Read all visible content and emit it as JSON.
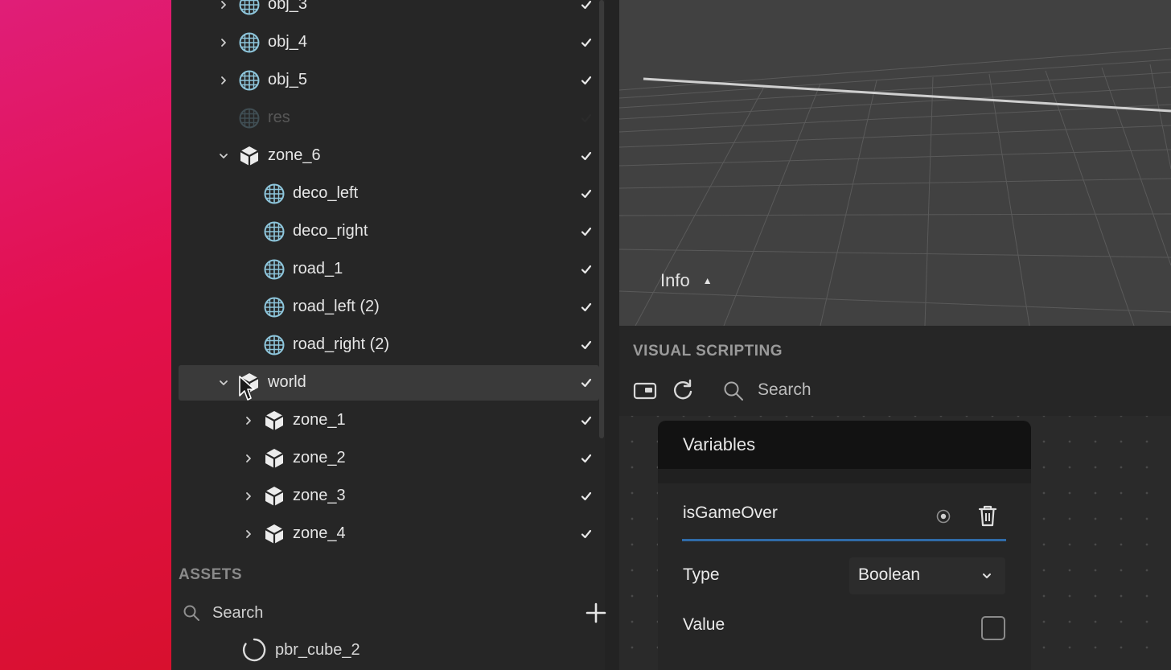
{
  "hierarchy": {
    "items": [
      {
        "label": "obj_3",
        "icon": "mesh-icon",
        "expander": "collapsed",
        "checked": true
      },
      {
        "label": "obj_4",
        "icon": "mesh-icon",
        "expander": "collapsed",
        "checked": true
      },
      {
        "label": "obj_5",
        "icon": "mesh-icon",
        "expander": "collapsed",
        "checked": true
      },
      {
        "label": "res",
        "icon": "mesh-icon",
        "expander": "none",
        "checked": false,
        "disabled": true
      },
      {
        "label": "zone_6",
        "icon": "prefab-icon",
        "expander": "expanded",
        "checked": true
      },
      {
        "label": "deco_left",
        "icon": "mesh-icon",
        "expander": "none",
        "checked": true
      },
      {
        "label": "deco_right",
        "icon": "mesh-icon",
        "expander": "none",
        "checked": true
      },
      {
        "label": "road_1",
        "icon": "mesh-icon",
        "expander": "none",
        "checked": true
      },
      {
        "label": "road_left (2)",
        "icon": "mesh-icon",
        "expander": "none",
        "checked": true
      },
      {
        "label": "road_right (2)",
        "icon": "mesh-icon",
        "expander": "none",
        "checked": true
      },
      {
        "label": "world",
        "icon": "prefab-icon",
        "expander": "expanded",
        "checked": true,
        "selected": true
      },
      {
        "label": "zone_1",
        "icon": "prefab-icon",
        "expander": "collapsed",
        "checked": true
      },
      {
        "label": "zone_2",
        "icon": "prefab-icon",
        "expander": "collapsed",
        "checked": true
      },
      {
        "label": "zone_3",
        "icon": "prefab-icon",
        "expander": "collapsed",
        "checked": true
      },
      {
        "label": "zone_4",
        "icon": "prefab-icon",
        "expander": "collapsed",
        "checked": true
      }
    ]
  },
  "assets": {
    "header": "ASSETS",
    "search_label": "Search",
    "items": [
      {
        "label": "pbr_cube_2",
        "icon": "material-icon"
      }
    ]
  },
  "viewport": {
    "info_label": "Info",
    "info_caret": "▲"
  },
  "visual_scripting": {
    "title": "VISUAL SCRIPTING",
    "search_label": "Search",
    "variables_card": {
      "title": "Variables",
      "variable_name": "isGameOver",
      "type_label": "Type",
      "type_value": "Boolean",
      "value_label": "Value",
      "value_checked": false
    }
  },
  "colors": {
    "accent_underline": "#2f6ba8",
    "panel_bg": "#262626",
    "viewport_bg": "#414141"
  }
}
